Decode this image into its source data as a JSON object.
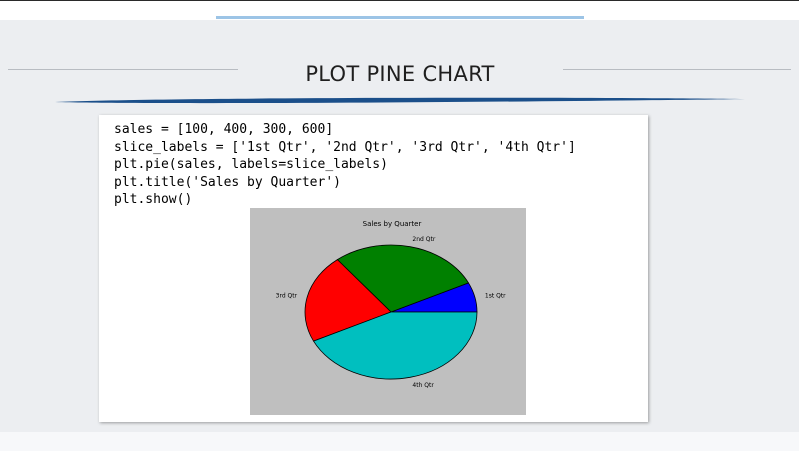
{
  "slide": {
    "title": "PLOT PINE CHART"
  },
  "code": {
    "lines": [
      "sales = [100, 400, 300, 600]",
      "slice_labels = ['1st Qtr', '2nd Qtr', '3rd Qtr', '4th Qtr']",
      "plt.pie(sales, labels=slice_labels)",
      "plt.title('Sales by Quarter')",
      "plt.show()"
    ]
  },
  "chart_data": {
    "type": "pie",
    "title": "Sales by Quarter",
    "categories": [
      "1st Qtr",
      "2nd Qtr",
      "3rd Qtr",
      "4th Qtr"
    ],
    "values": [
      100,
      400,
      300,
      600
    ],
    "colors": [
      "#0000ff",
      "#008000",
      "#ff0000",
      "#00bfbf"
    ],
    "background": "#bfbfbf"
  }
}
